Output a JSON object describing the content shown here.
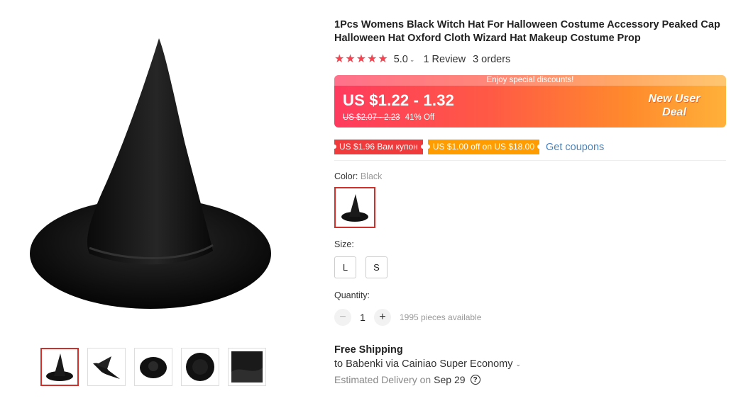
{
  "product": {
    "title": "1Pcs Womens Black Witch Hat For Halloween Costume Accessory Peaked Cap Halloween Hat Oxford Cloth Wizard Hat Makeup Costume Prop",
    "rating": "5.0",
    "reviews": "1 Review",
    "orders": "3 orders"
  },
  "price": {
    "banner_note": "Enjoy special discounts!",
    "current": "US $1.22 - 1.32",
    "original": "US $2.07 - 2.23",
    "discount": "41% Off",
    "deal_badge": "New User Deal"
  },
  "coupons": {
    "coupon1": "US $1.96 Вам купон",
    "coupon2": "US $1.00 off on US $18.00",
    "get_link": "Get coupons"
  },
  "options": {
    "color_label": "Color:",
    "color_value": "Black",
    "size_label": "Size:",
    "sizes": [
      "L",
      "S"
    ],
    "quantity_label": "Quantity:",
    "quantity_value": "1",
    "quantity_available": "1995 pieces available"
  },
  "shipping": {
    "title": "Free Shipping",
    "to": "to Babenki via Cainiao Super Economy",
    "delivery_label": "Estimated Delivery on",
    "delivery_date": "Sep 29"
  },
  "icons": {
    "star": "star-icon",
    "help": "help-icon",
    "chevron": "chevron-down-icon"
  },
  "colors": {
    "accent": "#d0302a",
    "star": "#f4424f",
    "link": "#2b6cb0"
  }
}
